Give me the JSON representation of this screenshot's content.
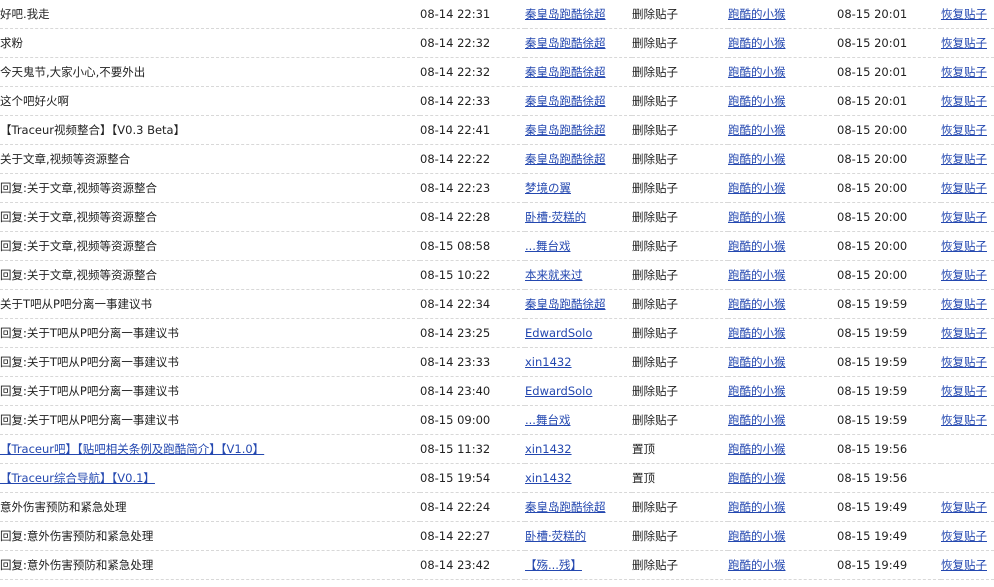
{
  "colors": {
    "link": "#2448b0",
    "text": "#222222",
    "row_separator": "#d8d8d8"
  },
  "rows": [
    {
      "title": "好吧.我走",
      "title_is_link": false,
      "post_time": "08-14 22:31",
      "author": "秦皇岛跑酷徐超",
      "action": "删除贴子",
      "operator": "跑酷的小猴",
      "op_time": "08-15 20:01",
      "restore": "恢复贴子"
    },
    {
      "title": "求粉",
      "title_is_link": false,
      "post_time": "08-14 22:32",
      "author": "秦皇岛跑酷徐超",
      "action": "删除贴子",
      "operator": "跑酷的小猴",
      "op_time": "08-15 20:01",
      "restore": "恢复贴子"
    },
    {
      "title": "今天鬼节,大家小心,不要外出",
      "title_is_link": false,
      "post_time": "08-14 22:32",
      "author": "秦皇岛跑酷徐超",
      "action": "删除贴子",
      "operator": "跑酷的小猴",
      "op_time": "08-15 20:01",
      "restore": "恢复贴子"
    },
    {
      "title": "这个吧好火啊",
      "title_is_link": false,
      "post_time": "08-14 22:33",
      "author": "秦皇岛跑酷徐超",
      "action": "删除贴子",
      "operator": "跑酷的小猴",
      "op_time": "08-15 20:01",
      "restore": "恢复贴子"
    },
    {
      "title": "【Traceur视频整合】【V0.3 Beta】",
      "title_is_link": false,
      "post_time": "08-14 22:41",
      "author": "秦皇岛跑酷徐超",
      "action": "删除贴子",
      "operator": "跑酷的小猴",
      "op_time": "08-15 20:00",
      "restore": "恢复贴子"
    },
    {
      "title": "关于文章,视频等资源整合",
      "title_is_link": false,
      "post_time": "08-14 22:22",
      "author": "秦皇岛跑酷徐超",
      "action": "删除贴子",
      "operator": "跑酷的小猴",
      "op_time": "08-15 20:00",
      "restore": "恢复贴子"
    },
    {
      "title": "回复:关于文章,视频等资源整合",
      "title_is_link": false,
      "post_time": "08-14 22:23",
      "author": "梦境の翼",
      "action": "删除贴子",
      "operator": "跑酷的小猴",
      "op_time": "08-15 20:00",
      "restore": "恢复贴子"
    },
    {
      "title": "回复:关于文章,视频等资源整合",
      "title_is_link": false,
      "post_time": "08-14 22:28",
      "author": "卧槽·荧糕的",
      "action": "删除贴子",
      "operator": "跑酷的小猴",
      "op_time": "08-15 20:00",
      "restore": "恢复贴子"
    },
    {
      "title": "回复:关于文章,视频等资源整合",
      "title_is_link": false,
      "post_time": "08-15 08:58",
      "author": "...舞台戏",
      "action": "删除贴子",
      "operator": "跑酷的小猴",
      "op_time": "08-15 20:00",
      "restore": "恢复贴子"
    },
    {
      "title": "回复:关于文章,视频等资源整合",
      "title_is_link": false,
      "post_time": "08-15 10:22",
      "author": "本来就来过",
      "action": "删除贴子",
      "operator": "跑酷的小猴",
      "op_time": "08-15 20:00",
      "restore": "恢复贴子"
    },
    {
      "title": "关于T吧从P吧分离一事建议书",
      "title_is_link": false,
      "post_time": "08-14 22:34",
      "author": "秦皇岛跑酷徐超",
      "action": "删除贴子",
      "operator": "跑酷的小猴",
      "op_time": "08-15 19:59",
      "restore": "恢复贴子"
    },
    {
      "title": "回复:关于T吧从P吧分离一事建议书",
      "title_is_link": false,
      "post_time": "08-14 23:25",
      "author": "EdwardSolo",
      "action": "删除贴子",
      "operator": "跑酷的小猴",
      "op_time": "08-15 19:59",
      "restore": "恢复贴子"
    },
    {
      "title": "回复:关于T吧从P吧分离一事建议书",
      "title_is_link": false,
      "post_time": "08-14 23:33",
      "author": "xin1432",
      "action": "删除贴子",
      "operator": "跑酷的小猴",
      "op_time": "08-15 19:59",
      "restore": "恢复贴子"
    },
    {
      "title": "回复:关于T吧从P吧分离一事建议书",
      "title_is_link": false,
      "post_time": "08-14 23:40",
      "author": "EdwardSolo",
      "action": "删除贴子",
      "operator": "跑酷的小猴",
      "op_time": "08-15 19:59",
      "restore": "恢复贴子"
    },
    {
      "title": "回复:关于T吧从P吧分离一事建议书",
      "title_is_link": false,
      "post_time": "08-15 09:00",
      "author": "...舞台戏",
      "action": "删除贴子",
      "operator": "跑酷的小猴",
      "op_time": "08-15 19:59",
      "restore": "恢复贴子"
    },
    {
      "title": "【Traceur吧】【贴吧相关条例及跑酷简介】【V1.0】",
      "title_is_link": true,
      "post_time": "08-15 11:32",
      "author": "xin1432",
      "action": "置顶",
      "operator": "跑酷的小猴",
      "op_time": "08-15 19:56",
      "restore": ""
    },
    {
      "title": "【Traceur综合导航】【V0.1】",
      "title_is_link": true,
      "post_time": "08-15 19:54",
      "author": "xin1432",
      "action": "置顶",
      "operator": "跑酷的小猴",
      "op_time": "08-15 19:56",
      "restore": ""
    },
    {
      "title": "意外伤害预防和紧急处理",
      "title_is_link": false,
      "post_time": "08-14 22:24",
      "author": "秦皇岛跑酷徐超",
      "action": "删除贴子",
      "operator": "跑酷的小猴",
      "op_time": "08-15 19:49",
      "restore": "恢复贴子"
    },
    {
      "title": "回复:意外伤害预防和紧急处理",
      "title_is_link": false,
      "post_time": "08-14 22:27",
      "author": "卧槽·荧糕的",
      "action": "删除贴子",
      "operator": "跑酷的小猴",
      "op_time": "08-15 19:49",
      "restore": "恢复贴子"
    },
    {
      "title": "回复:意外伤害预防和紧急处理",
      "title_is_link": false,
      "post_time": "08-14 23:42",
      "author": "【殇...残】",
      "action": "删除贴子",
      "operator": "跑酷的小猴",
      "op_time": "08-15 19:49",
      "restore": "恢复贴子"
    }
  ]
}
